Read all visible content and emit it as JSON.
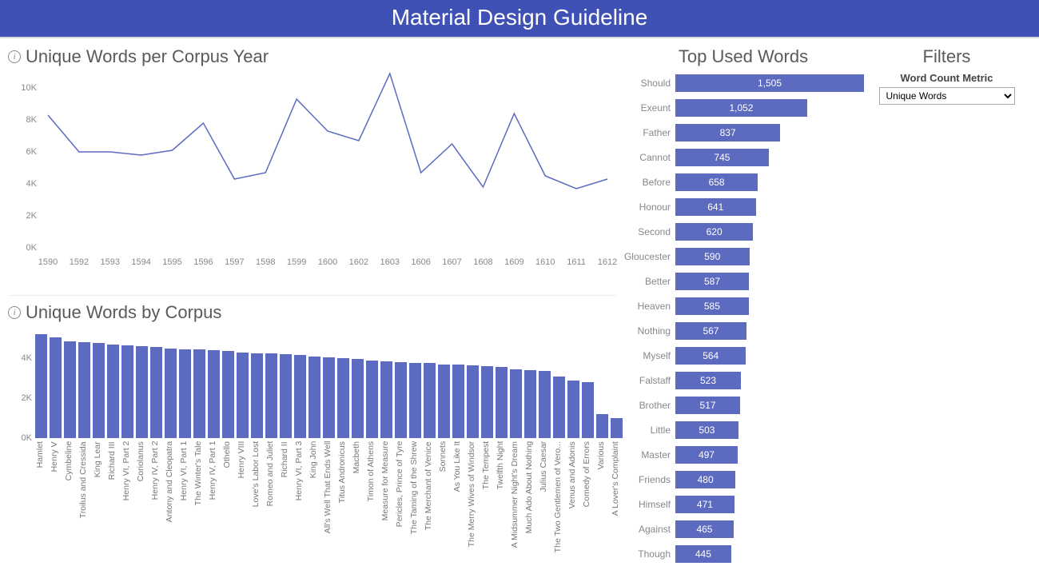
{
  "header": {
    "title": "Material Design Guideline"
  },
  "line_panel": {
    "title": "Unique Words per Corpus Year"
  },
  "bar_panel": {
    "title": "Unique Words by Corpus"
  },
  "topwords_panel": {
    "title": "Top Used Words"
  },
  "filters_panel": {
    "title": "Filters",
    "metric_label": "Word Count Metric",
    "metric_value": "Unique Words"
  },
  "chart_data": [
    {
      "type": "line",
      "title": "Unique Words per Corpus Year",
      "xlabel": "",
      "ylabel": "",
      "ylim": [
        0,
        11000
      ],
      "y_ticks": [
        "0K",
        "2K",
        "4K",
        "6K",
        "8K",
        "10K"
      ],
      "categories": [
        "1590",
        "1592",
        "1593",
        "1594",
        "1595",
        "1596",
        "1597",
        "1598",
        "1599",
        "1600",
        "1602",
        "1603",
        "1606",
        "1607",
        "1608",
        "1609",
        "1610",
        "1611",
        "1612"
      ],
      "values": [
        8300,
        6000,
        6000,
        5800,
        6100,
        7800,
        4300,
        4700,
        9300,
        7300,
        6700,
        10900,
        4700,
        6500,
        3800,
        8400,
        4500,
        3700,
        4300
      ]
    },
    {
      "type": "bar",
      "title": "Unique Words by Corpus",
      "xlabel": "",
      "ylabel": "",
      "ylim": [
        0,
        5200
      ],
      "y_ticks": [
        "0K",
        "2K",
        "4K"
      ],
      "categories": [
        "Hamlet",
        "Henry V",
        "Cymbeline",
        "Troilus and Cressida",
        "King Lear",
        "Richard III",
        "Henry VI, Part 2",
        "Coriolanus",
        "Henry IV, Part 2",
        "Antony and Cleopatra",
        "Henry VI, Part 1",
        "The Winter's Tale",
        "Henry IV, Part 1",
        "Othello",
        "Henry VIII",
        "Love's Labor Lost",
        "Romeo and Juliet",
        "Richard II",
        "Henry VI, Part 3",
        "King John",
        "All's Well That Ends Well",
        "Titus Andronicus",
        "Macbeth",
        "Timon of Athens",
        "Measure for Measure",
        "Pericles, Prince of Tyre",
        "The Taming of the Shrew",
        "The Merchant of Venice",
        "Sonnets",
        "As You Like It",
        "The Merry Wives of Windsor",
        "The Tempest",
        "Twelfth Night",
        "A Midsummer Night's Dream",
        "Much Ado About Nothing",
        "Julius Caesar",
        "The Two Gentlemen of Vero...",
        "Venus and Adonis",
        "Comedy of Errors",
        "Various",
        "A Lover's Complaint"
      ],
      "values": [
        5200,
        5050,
        4850,
        4800,
        4750,
        4700,
        4650,
        4600,
        4550,
        4500,
        4450,
        4450,
        4400,
        4350,
        4300,
        4250,
        4250,
        4200,
        4150,
        4100,
        4050,
        4000,
        3950,
        3900,
        3850,
        3800,
        3750,
        3750,
        3700,
        3700,
        3650,
        3600,
        3550,
        3450,
        3400,
        3350,
        3100,
        2900,
        2800,
        1200,
        1000
      ]
    },
    {
      "type": "bar",
      "title": "Top Used Words",
      "orientation": "horizontal",
      "xlim": [
        0,
        1505
      ],
      "categories": [
        "Should",
        "Exeunt",
        "Father",
        "Cannot",
        "Before",
        "Honour",
        "Second",
        "Gloucester",
        "Better",
        "Heaven",
        "Nothing",
        "Myself",
        "Falstaff",
        "Brother",
        "Little",
        "Master",
        "Friends",
        "Himself",
        "Against",
        "Though"
      ],
      "values": [
        1505,
        1052,
        837,
        745,
        658,
        641,
        620,
        590,
        587,
        585,
        567,
        564,
        523,
        517,
        503,
        497,
        480,
        471,
        465,
        445
      ]
    }
  ]
}
